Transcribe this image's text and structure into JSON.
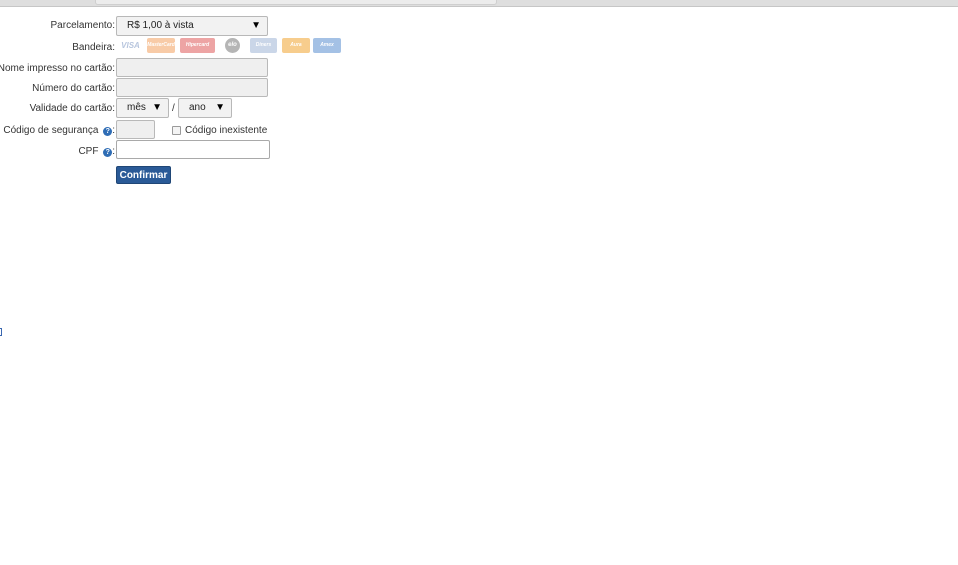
{
  "form": {
    "installments": {
      "label": "Parcelamento:",
      "selected": "R$ 1,00 à vista"
    },
    "brand": {
      "label": "Bandeira:",
      "options": [
        {
          "name": "VISA",
          "color": "#c9d6ea",
          "text": "VISA"
        },
        {
          "name": "Mastercard",
          "color": "#f4a261",
          "text": "MasterCard"
        },
        {
          "name": "Hipercard",
          "color": "#e05a5a",
          "text": "Hipercard"
        },
        {
          "name": "Elo",
          "color": "#7a7a7a",
          "text": "elo"
        },
        {
          "name": "Diners",
          "color": "#9fb6d6",
          "text": "Diners"
        },
        {
          "name": "Aura",
          "color": "#f2a531",
          "text": "Aura"
        },
        {
          "name": "Amex",
          "color": "#5b8fd1",
          "text": "Amex"
        }
      ]
    },
    "cardholder": {
      "label": "Nome impresso no cartão:"
    },
    "card_number": {
      "label": "Número do cartão:"
    },
    "expiry": {
      "label": "Validade do cartão:",
      "month_selected": "mês",
      "separator": "/",
      "year_selected": "ano"
    },
    "security_code": {
      "label": "Código de segurança",
      "colon": ":",
      "no_code_label": "Código inexistente"
    },
    "cpf": {
      "label": "CPF",
      "colon": ":"
    },
    "confirm_label": "Confirmar"
  },
  "colors": {
    "primary_button": "#2a5a97",
    "help_icon": "#2f6db5"
  }
}
